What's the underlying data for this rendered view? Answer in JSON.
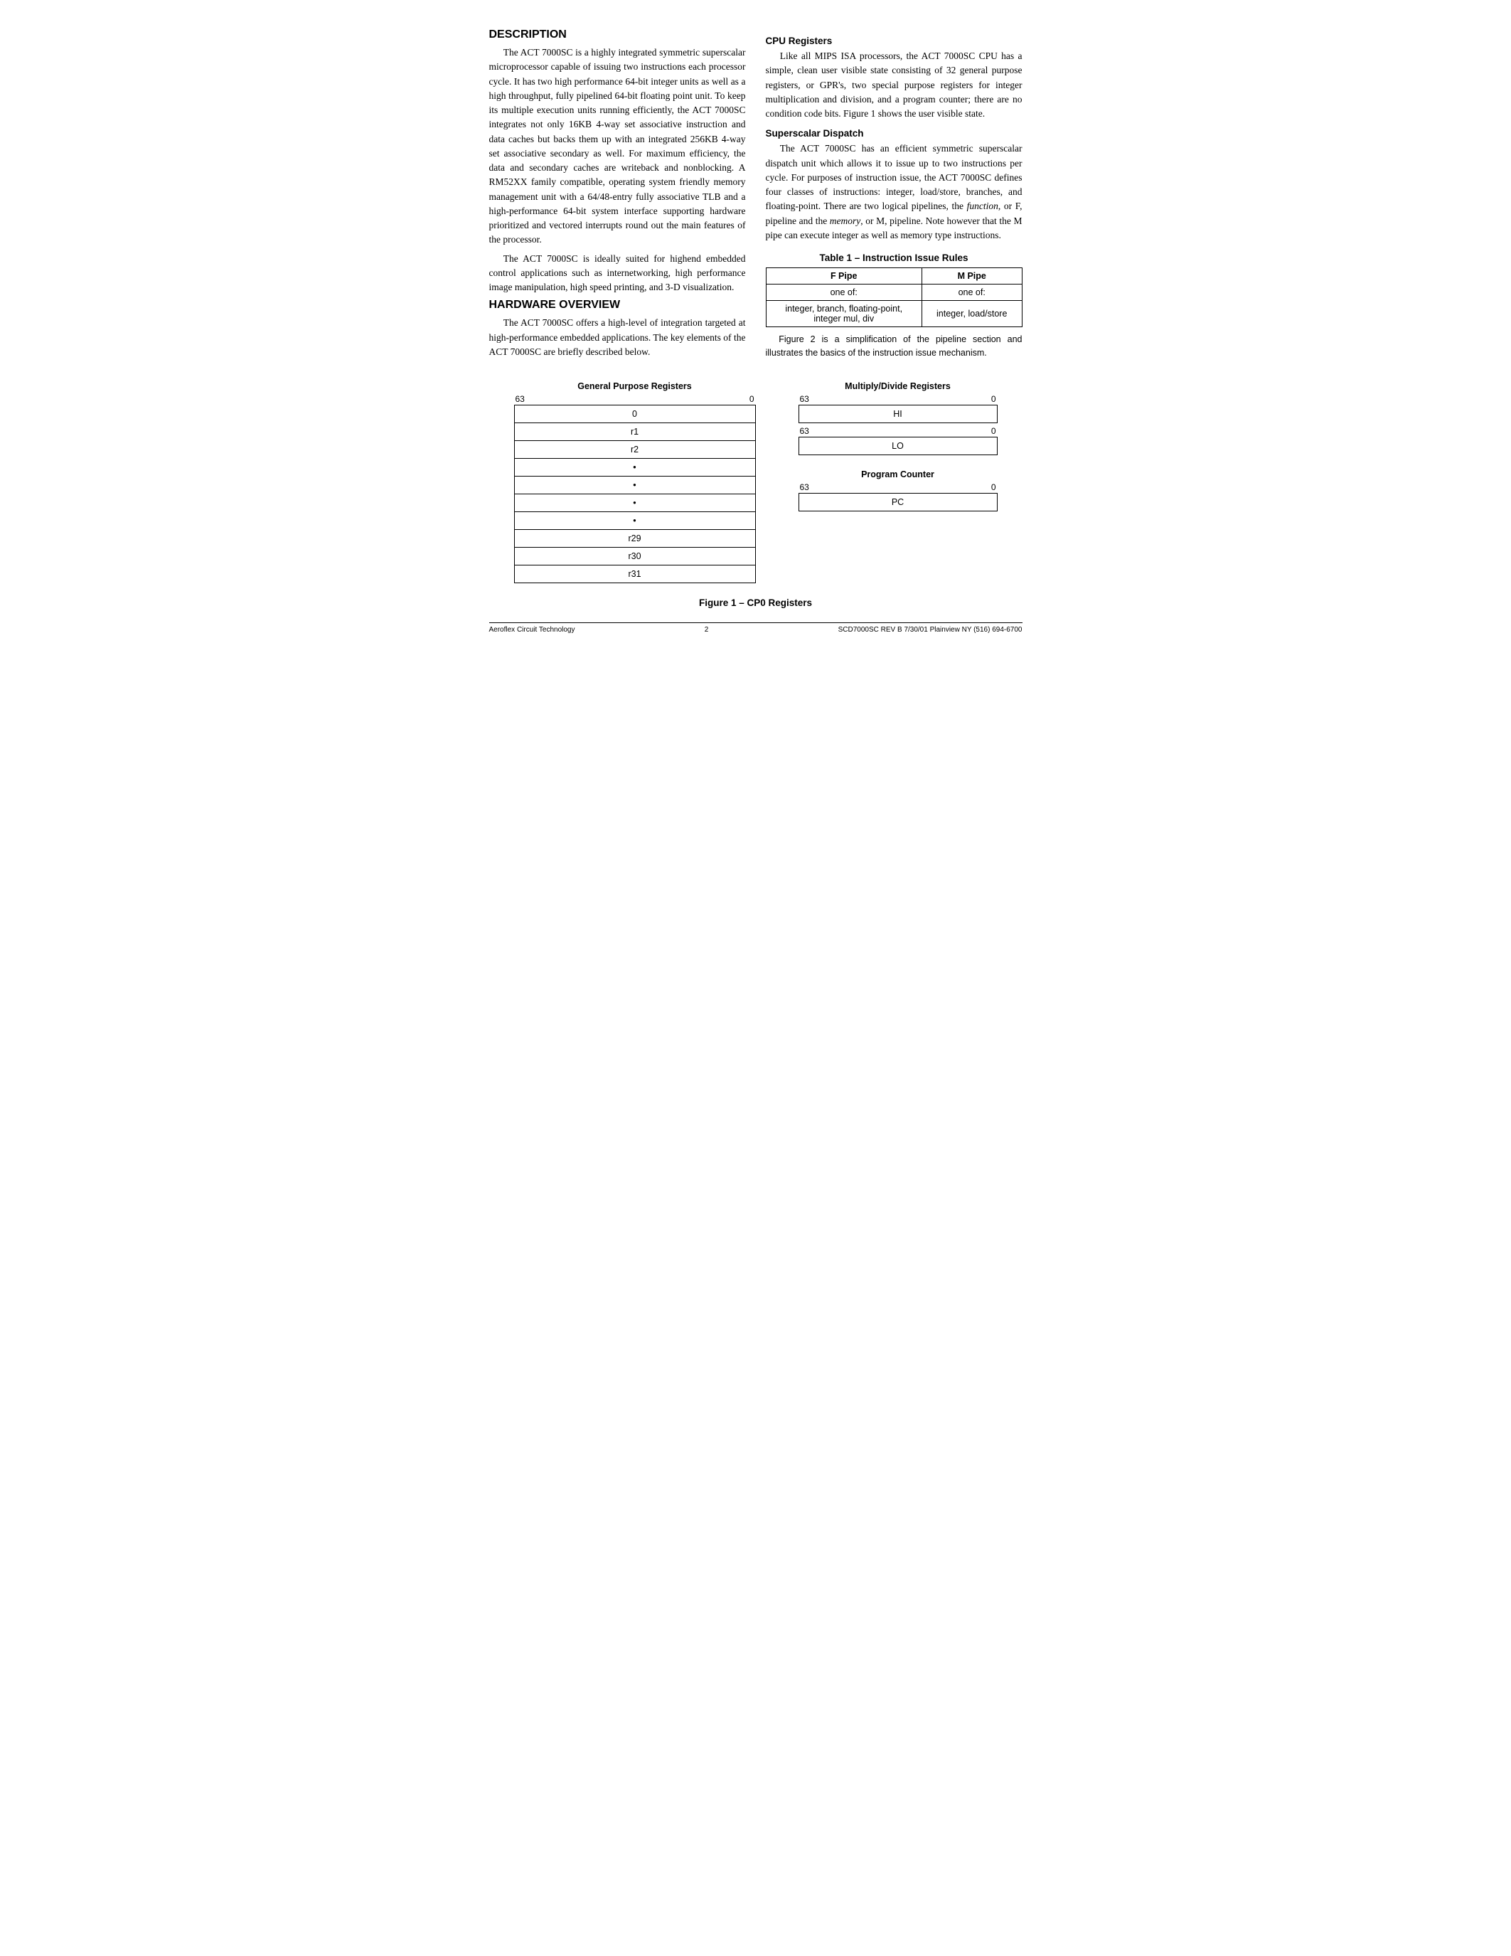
{
  "page": {
    "description_heading": "DESCRIPTION",
    "description_p1": "The ACT 7000SC is a highly integrated symmetric superscalar microprocessor capable of issuing two instructions each processor cycle. It has two high performance 64-bit integer units as well as a high throughput, fully pipelined 64-bit floating point unit. To keep its multiple execution units running efficiently, the ACT 7000SC integrates not only 16KB 4-way set associative instruction and data caches but backs them up with an integrated 256KB 4-way set associative secondary as well. For maximum efficiency, the data and secondary caches are writeback and nonblocking. A RM52XX family compatible, operating system friendly memory management unit with a 64/48-entry fully associative TLB and a high-performance 64-bit system interface supporting hardware prioritized and vectored interrupts round out the main features of the processor.",
    "description_p2": "The ACT 7000SC is ideally suited for highend embedded control applications such as internetworking, high performance image manipulation, high speed printing, and 3-D visualization.",
    "hardware_heading": "HARDWARE OVERVIEW",
    "hardware_p1": "The ACT 7000SC offers a high-level of integration targeted at high-performance embedded applications. The key elements of the ACT 7000SC are briefly described below.",
    "cpu_registers_heading": "CPU Registers",
    "cpu_registers_p": "Like all MIPS ISA processors, the ACT 7000SC CPU has a simple, clean user visible state consisting of 32 general purpose registers, or GPR's, two special purpose registers for integer multiplication and division, and a program counter; there are no condition code bits. Figure 1 shows the user visible state.",
    "superscalar_heading": "Superscalar Dispatch",
    "superscalar_p": "The ACT 7000SC has an efficient symmetric superscalar dispatch unit which allows it to issue up to two instructions per cycle. For purposes of instruction issue, the ACT 7000SC defines four classes of instructions: integer, load/store, branches, and floating-point. There are two logical pipelines, the function, or F, pipeline and the memory, or M, pipeline. Note however that the M pipe can execute integer as well as memory type instructions.",
    "table_title": "Table 1 – Instruction Issue Rules",
    "table_headers": [
      "F Pipe",
      "M Pipe"
    ],
    "table_row1": [
      "one of:",
      "one of:"
    ],
    "table_row2": [
      "integer, branch, floating-point,\ninteger mul, div",
      "integer, load/store"
    ],
    "table_note": "Figure 2 is a simplification of the pipeline section and illustrates the basics of the instruction issue mechanism.",
    "figure_section": {
      "gpr_label": "General Purpose Registers",
      "gpr_bit_left": "63",
      "gpr_bit_right": "0",
      "gpr_rows": [
        "0",
        "r1",
        "r2",
        "•",
        "•",
        "•",
        "•",
        "r29",
        "r30",
        "r31"
      ],
      "md_label": "Multiply/Divide Registers",
      "md_hi_bit_left": "63",
      "md_hi_bit_right": "0",
      "md_hi_row": "HI",
      "md_lo_bit_left": "63",
      "md_lo_bit_right": "0",
      "md_lo_row": "LO",
      "pc_label": "Program Counter",
      "pc_bit_left": "63",
      "pc_bit_right": "0",
      "pc_row": "PC"
    },
    "figure_caption": "Figure 1 – CP0 Registers",
    "footer": {
      "left": "Aeroflex Circuit Technology",
      "center": "2",
      "right": "SCD7000SC REV B  7/30/01  Plainview NY (516) 694-6700"
    }
  }
}
